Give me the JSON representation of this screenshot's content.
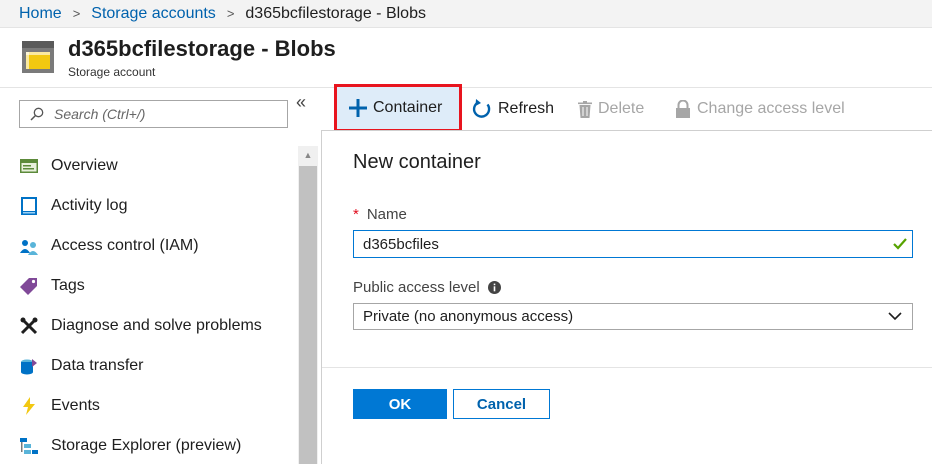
{
  "breadcrumb": {
    "items": [
      "Home",
      "Storage accounts",
      "d365bcfilestorage - Blobs"
    ]
  },
  "header": {
    "title": "d365bcfilestorage - Blobs",
    "subtitle": "Storage account"
  },
  "sidebar": {
    "collapse_glyph": "«",
    "search": {
      "placeholder": "Search (Ctrl+/)",
      "value": ""
    },
    "items": [
      {
        "label": "Overview",
        "icon": "overview-icon"
      },
      {
        "label": "Activity log",
        "icon": "activity-log-icon"
      },
      {
        "label": "Access control (IAM)",
        "icon": "iam-icon"
      },
      {
        "label": "Tags",
        "icon": "tag-icon"
      },
      {
        "label": "Diagnose and solve problems",
        "icon": "wrench-icon"
      },
      {
        "label": "Data transfer",
        "icon": "data-transfer-icon"
      },
      {
        "label": "Events",
        "icon": "lightning-icon"
      },
      {
        "label": "Storage Explorer (preview)",
        "icon": "storage-explorer-icon"
      }
    ]
  },
  "toolbar": {
    "container_label": "Container",
    "refresh_label": "Refresh",
    "delete_label": "Delete",
    "change_access_label": "Change access level"
  },
  "new_container": {
    "title": "New container",
    "name_label": "Name",
    "required_marker": "*",
    "name_value": "d365bcfiles",
    "access_label": "Public access level",
    "access_value": "Private (no anonymous access)",
    "ok_label": "OK",
    "cancel_label": "Cancel"
  },
  "colors": {
    "accent": "#0078d4",
    "link": "#0062ad",
    "highlight_border": "#e8141e",
    "required": "#e00b1c",
    "valid_check": "#57a300"
  }
}
